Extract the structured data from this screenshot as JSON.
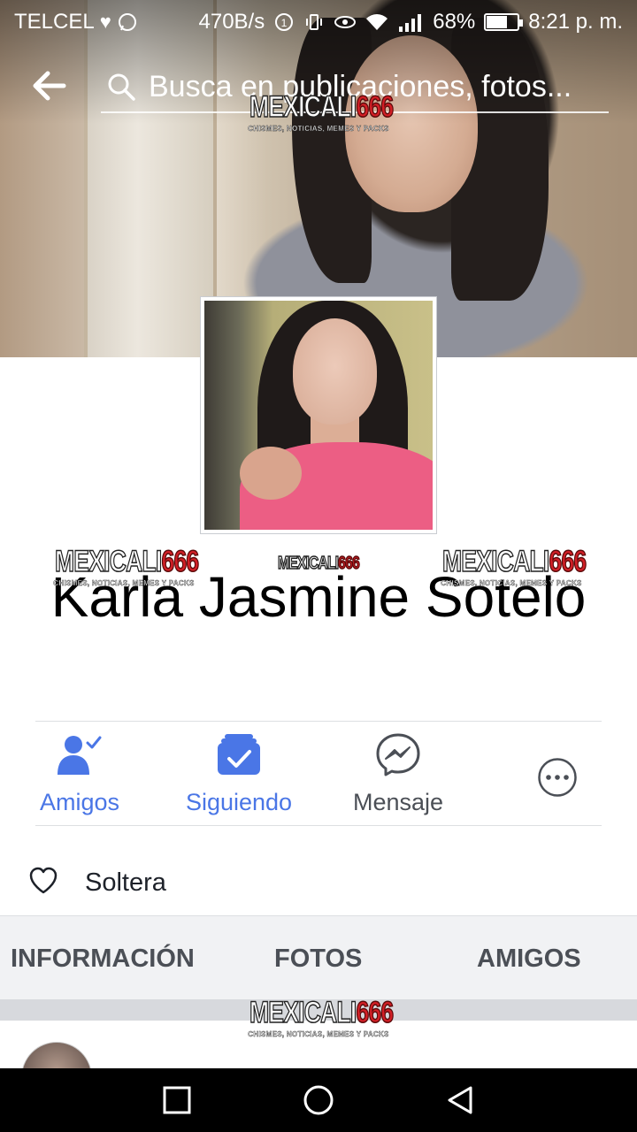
{
  "status_bar": {
    "carrier": "TELCEL",
    "speed": "470B/s",
    "battery": "68%",
    "battery_level": 0.68,
    "time": "8:21 p. m."
  },
  "search": {
    "placeholder": "Busca en publicaciones, fotos..."
  },
  "watermark": {
    "brand": "MEXICALI",
    "number": "666",
    "tagline": "CHISMES, NOTICIAS, MEMES Y PACKS"
  },
  "profile": {
    "name": "Karla Jasmine Sotelo"
  },
  "actions": {
    "friends": "Amigos",
    "following": "Siguiendo",
    "message": "Mensaje"
  },
  "relationship": {
    "status": "Soltera"
  },
  "tabs": {
    "info": "INFORMACIÓN",
    "photos": "FOTOS",
    "friends": "AMIGOS"
  },
  "colors": {
    "accent_blue": "#4a76e6",
    "brand_red": "#d31f26"
  }
}
